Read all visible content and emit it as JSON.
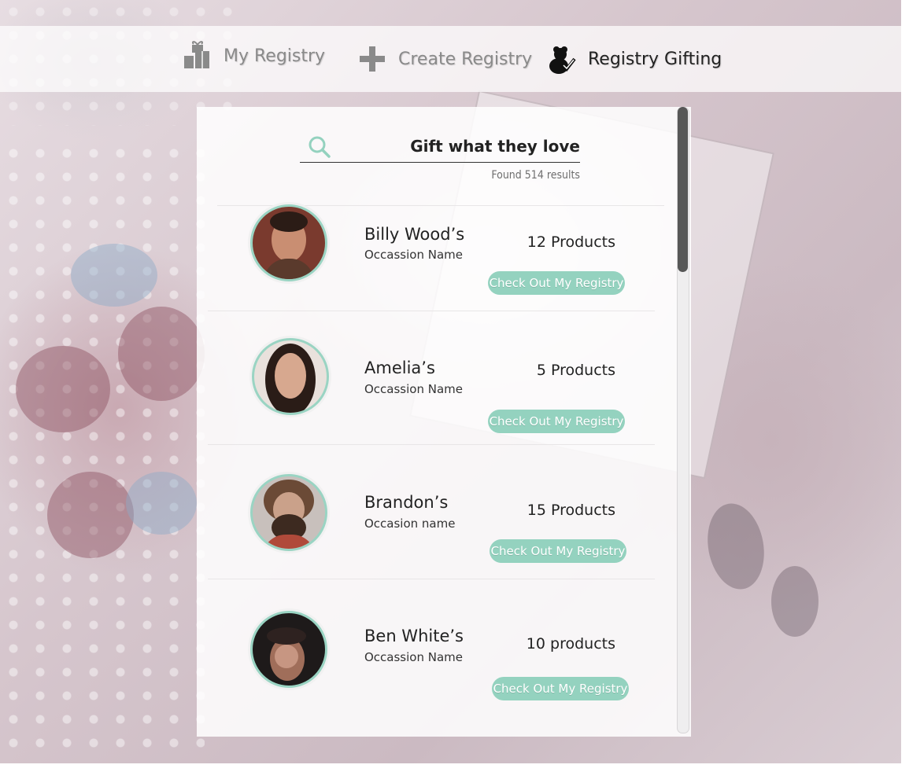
{
  "nav": {
    "items": [
      {
        "label": "My Registry",
        "icon": "gift-boxes-icon"
      },
      {
        "label": "Create Registry",
        "icon": "plus-icon"
      },
      {
        "label": "Registry Gifting",
        "icon": "teddy-check-icon",
        "active": true
      }
    ]
  },
  "search": {
    "icon": "search-icon",
    "value": "Gift what they love",
    "results_text": "Found 514 results"
  },
  "registries": [
    {
      "name": "Billy Wood’s",
      "occasion": "Occassion Name",
      "products": "12 Products",
      "cta": "Check Out My Registry"
    },
    {
      "name": "Amelia’s",
      "occasion": "Occassion Name",
      "products": "5 Products",
      "cta": "Check Out My Registry"
    },
    {
      "name": "Brandon’s",
      "occasion": "Occasion name",
      "products": "15 Products",
      "cta": "Check Out My Registry"
    },
    {
      "name": "Ben White’s",
      "occasion": "Occassion Name",
      "products": "10 products",
      "cta": "Check Out My Registry"
    }
  ],
  "colors": {
    "accent": "#94d2bf",
    "avatar_ring": "#9ad4c3",
    "scroll_thumb": "#575757"
  }
}
